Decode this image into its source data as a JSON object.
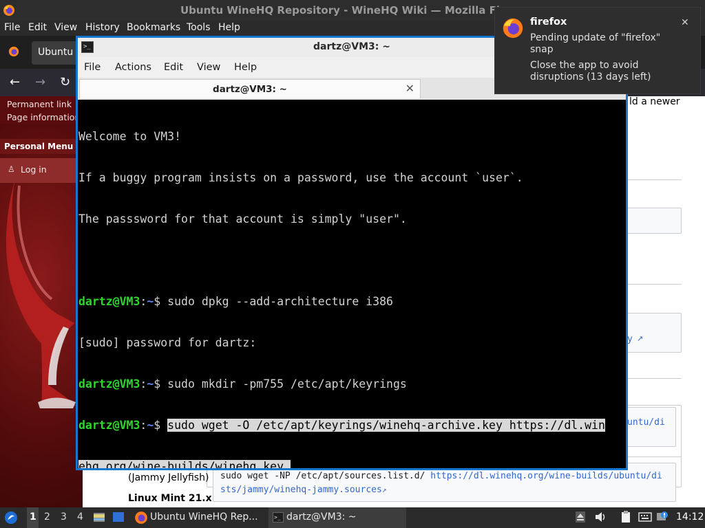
{
  "firefox": {
    "title": "Ubuntu WineHQ Repository - WineHQ Wiki — Mozilla Fi",
    "menu": [
      "File",
      "Edit",
      "View",
      "History",
      "Bookmarks",
      "Tools",
      "Help"
    ],
    "tab_label": "Ubuntu W",
    "page": {
      "sidebar_links": [
        "Permanent link",
        "Page information"
      ],
      "personal_menu": "Personal Menu",
      "login_label": "Log in",
      "snippet_newer": "ld a newer",
      "snippet_link_tail": "y",
      "snippet_path_tail": "untu/di",
      "table_label_1": "(Jammy Jellyfish)",
      "table_label_2": "Linux Mint 21.x",
      "code_cmd": "sudo wget -NP /etc/apt/sources.list.d/ ",
      "code_url_1": "https://dl.winehq.org/wine-builds/ubuntu/di",
      "code_url_2": "sts/jammy/winehq-jammy.sources"
    }
  },
  "terminal": {
    "title": "dartz@VM3: ~",
    "menu": [
      "File",
      "Actions",
      "Edit",
      "View",
      "Help"
    ],
    "tab_title": "dartz@VM3: ~",
    "lines": {
      "welcome": "Welcome to VM3!",
      "info1": "If a buggy program insists on a password, use the account `user`.",
      "info2": "The passsword for that account is simply \"user\".",
      "user": "dartz@VM3",
      "colon": ":",
      "path": "~",
      "dollar": "$ ",
      "cmd1": "sudo dpkg --add-architecture i386",
      "sudo_prompt": "[sudo] password for dartz:",
      "cmd2": "sudo mkdir -pm755 /etc/apt/keyrings",
      "cmd3a": "sudo wget -O /etc/apt/keyrings/winehq-archive.key https://dl.win",
      "cmd3b": "ehq.org/wine-builds/winehq.key"
    }
  },
  "notification": {
    "app": "firefox",
    "line1": "Pending update of \"firefox\"",
    "line2": "snap",
    "line3": "Close the app to avoid",
    "line4": "disruptions (13 days left)"
  },
  "taskbar": {
    "workspaces": [
      "1",
      "2",
      "3",
      "4"
    ],
    "active_workspace": "1",
    "tasks": [
      {
        "label": "Ubuntu WineHQ Rep..."
      },
      {
        "label": "dartz@VM3: ~"
      }
    ],
    "clock": "14:12"
  },
  "colors": {
    "terminal_border": "#1677d2",
    "prompt_user": "#2ed62e",
    "prompt_path": "#5f85ff",
    "wine_background": "#5a0b0b"
  }
}
